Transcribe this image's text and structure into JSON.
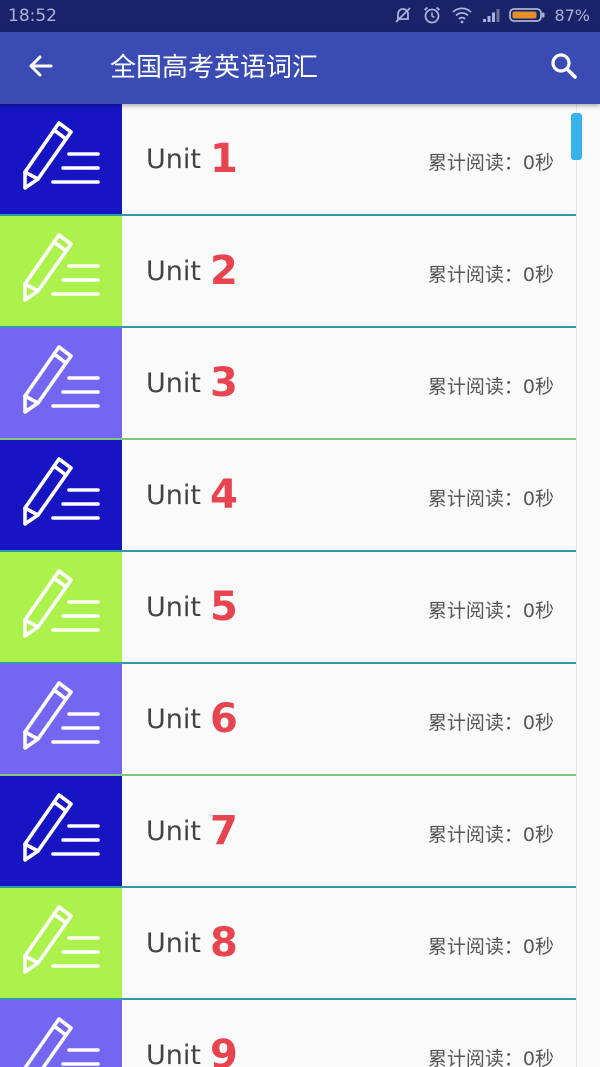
{
  "status_bar": {
    "time": "18:52",
    "battery": "87%",
    "icons": [
      "mute-icon",
      "alarm-icon",
      "wifi-icon",
      "signal-icon",
      "battery-icon"
    ]
  },
  "app_bar": {
    "title": "全国高考英语词汇",
    "back_icon": "arrow-left-icon",
    "search_icon": "search-icon"
  },
  "colors": {
    "status_bar": "#19236a",
    "app_bar": "#3a4cb3",
    "unit_number": "#e8444f",
    "thumb_colors": [
      "#1714c4",
      "#adf24c",
      "#7466f0"
    ],
    "scroll_thumb": "#38b2ea"
  },
  "units": [
    {
      "label": "Unit",
      "number": "1",
      "read": "累计阅读：0秒",
      "thumb_color": "#1714c4",
      "icon": "pencil-lines-icon"
    },
    {
      "label": "Unit",
      "number": "2",
      "read": "累计阅读：0秒",
      "thumb_color": "#adf24c",
      "icon": "pencil-lines-icon"
    },
    {
      "label": "Unit",
      "number": "3",
      "read": "累计阅读：0秒",
      "thumb_color": "#7466f0",
      "icon": "pencil-lines-icon"
    },
    {
      "label": "Unit",
      "number": "4",
      "read": "累计阅读：0秒",
      "thumb_color": "#1714c4",
      "icon": "pencil-lines-icon"
    },
    {
      "label": "Unit",
      "number": "5",
      "read": "累计阅读：0秒",
      "thumb_color": "#adf24c",
      "icon": "pencil-lines-icon"
    },
    {
      "label": "Unit",
      "number": "6",
      "read": "累计阅读：0秒",
      "thumb_color": "#7466f0",
      "icon": "pencil-lines-icon"
    },
    {
      "label": "Unit",
      "number": "7",
      "read": "累计阅读：0秒",
      "thumb_color": "#1714c4",
      "icon": "pencil-lines-icon"
    },
    {
      "label": "Unit",
      "number": "8",
      "read": "累计阅读：0秒",
      "thumb_color": "#adf24c",
      "icon": "pencil-lines-icon"
    },
    {
      "label": "Unit",
      "number": "9",
      "read": "累计阅读：0秒",
      "thumb_color": "#7466f0",
      "icon": "pencil-lines-icon"
    }
  ]
}
